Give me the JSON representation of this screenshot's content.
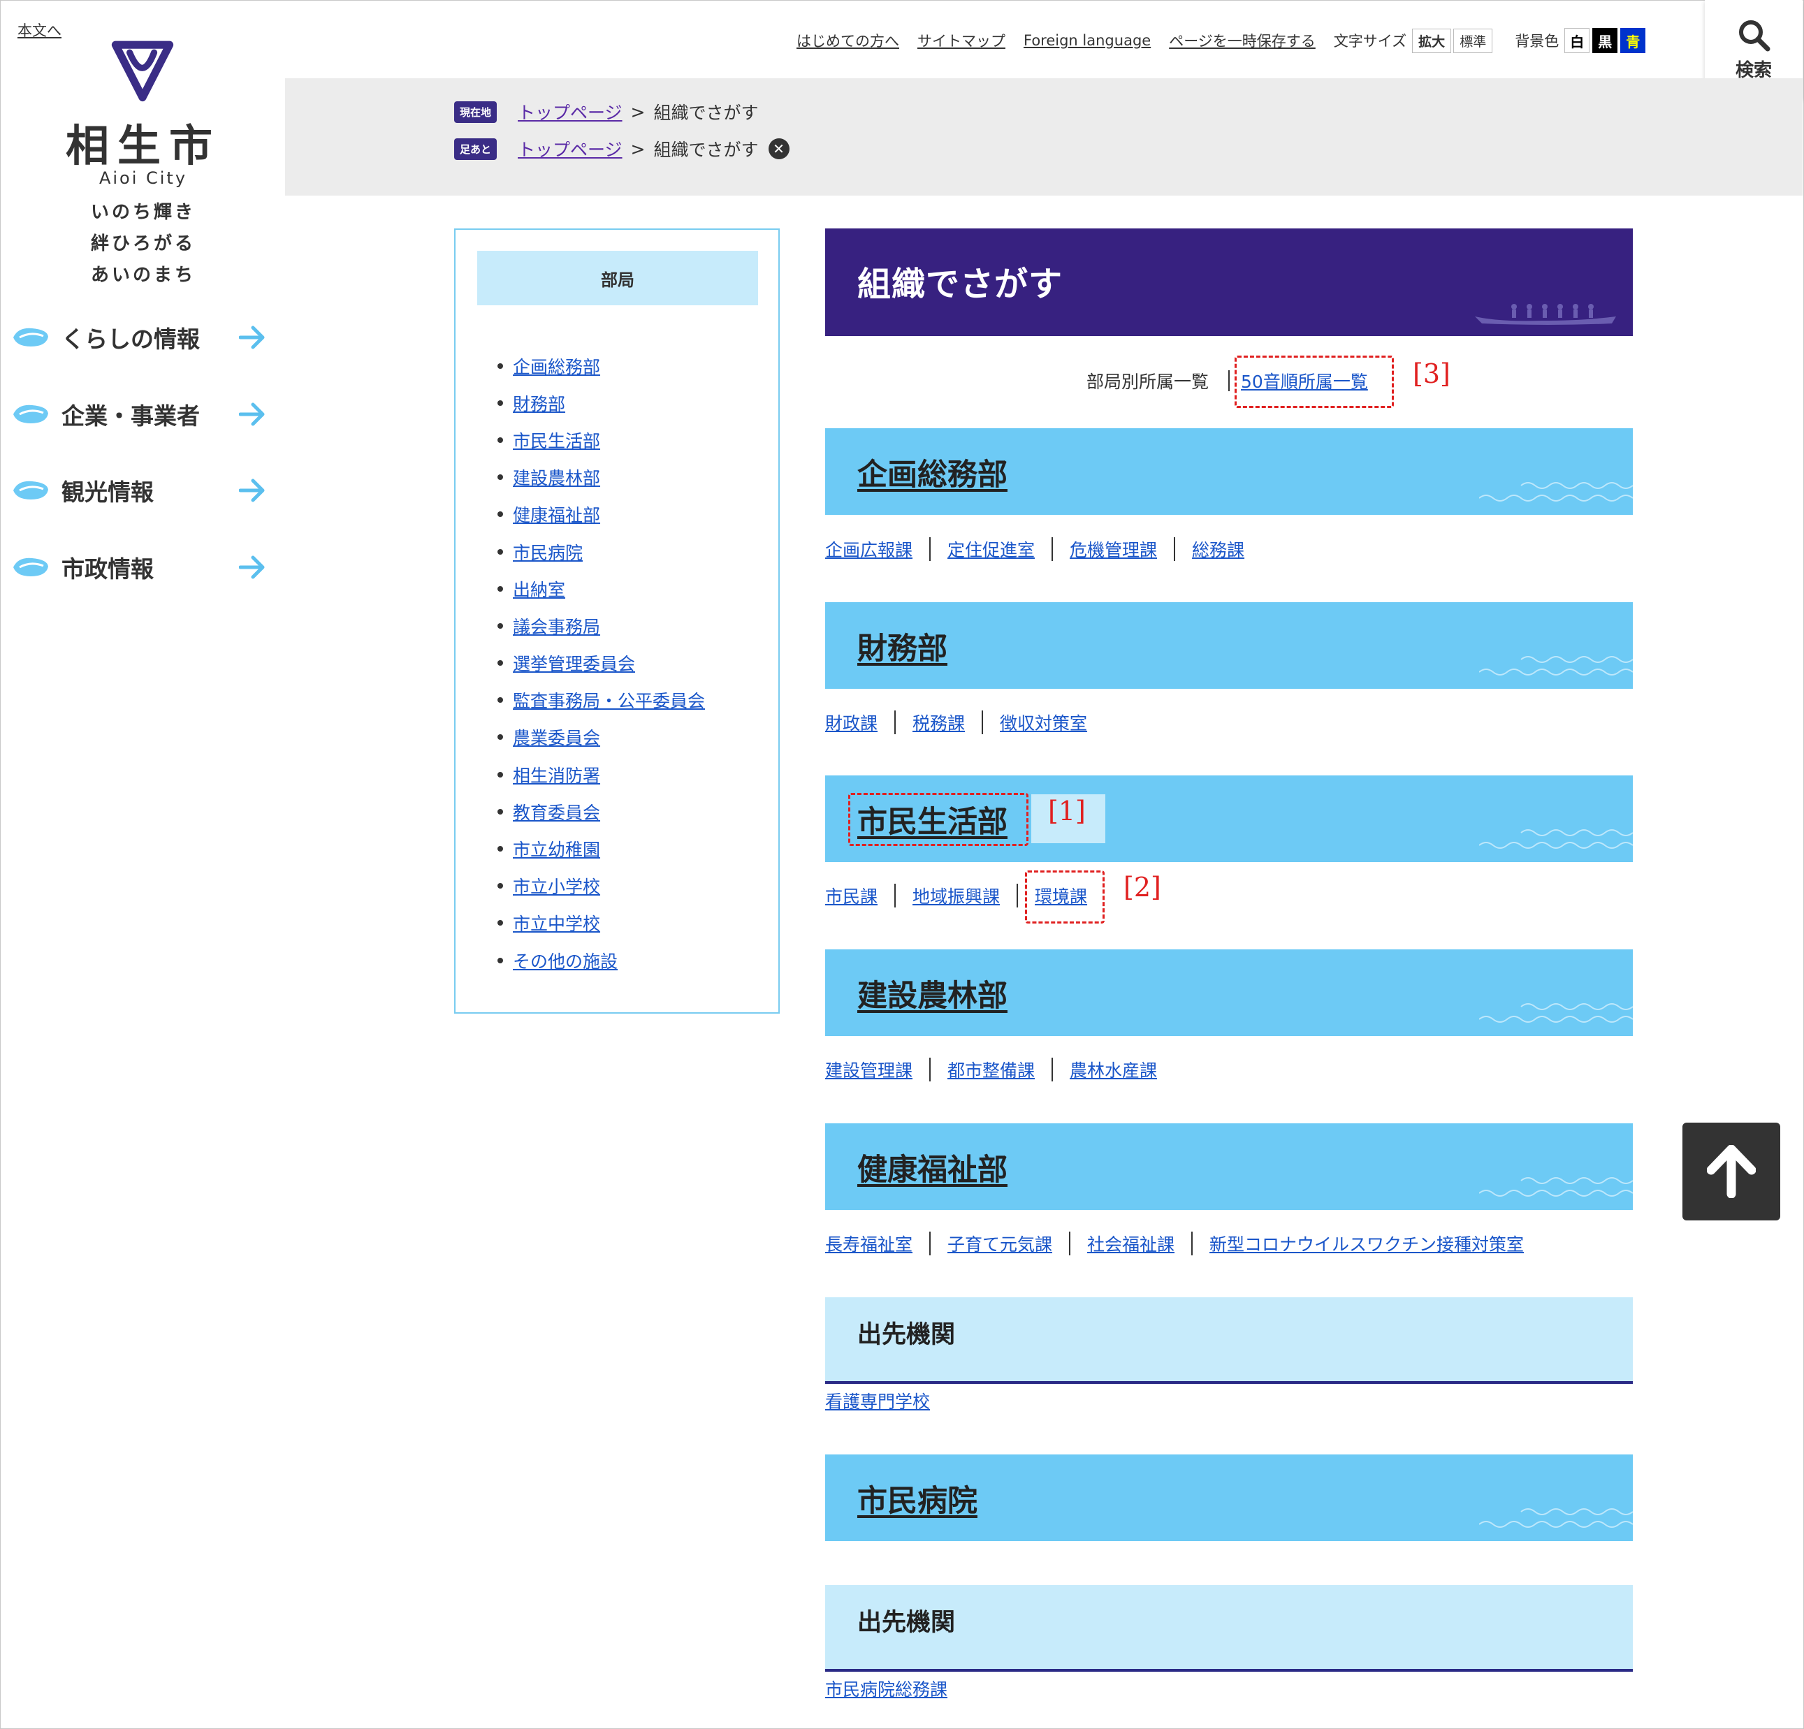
{
  "skip_link": "本文へ",
  "city": {
    "name": "相生市",
    "name_en": "Aioi City",
    "slogan": [
      "いのち輝き",
      "絆ひろがる",
      "あいのまち"
    ]
  },
  "global_nav": [
    {
      "label": "くらしの情報"
    },
    {
      "label": "企業・事業者"
    },
    {
      "label": "観光情報"
    },
    {
      "label": "市政情報"
    }
  ],
  "utility": {
    "links": [
      "はじめての方へ",
      "サイトマップ",
      "Foreign language",
      "ページを一時保存する"
    ],
    "font_size_label": "文字サイズ",
    "font_size_buttons": [
      "拡大",
      "標準"
    ],
    "bg_label": "背景色",
    "bg_buttons": [
      {
        "label": "白",
        "bg": "#ffffff",
        "fg": "#000000"
      },
      {
        "label": "黒",
        "bg": "#000000",
        "fg": "#ffffff"
      },
      {
        "label": "青",
        "bg": "#0033cc",
        "fg": "#ffff00"
      }
    ],
    "search_label": "検索"
  },
  "breadcrumb": {
    "current_badge": "現在地",
    "history_badge": "足あと",
    "top_link": "トップページ",
    "separator": ">",
    "current_page": "組織でさがす"
  },
  "side_menu": {
    "heading": "部局",
    "items": [
      "企画総務部",
      "財務部",
      "市民生活部",
      "建設農林部",
      "健康福祉部",
      "市民病院",
      "出納室",
      "議会事務局",
      "選挙管理委員会",
      "監査事務局・公平委員会",
      "農業委員会",
      "相生消防署",
      "教育委員会",
      "市立幼稚園",
      "市立小学校",
      "市立中学校",
      "その他の施設"
    ]
  },
  "main": {
    "title": "組織でさがす",
    "subnav": {
      "current": "部局別所属一覧",
      "link": "50音順所属一覧"
    },
    "departments": [
      {
        "name": "企画総務部",
        "sections": [
          "企画広報課",
          "定住促進室",
          "危機管理課",
          "総務課"
        ]
      },
      {
        "name": "財務部",
        "sections": [
          "財政課",
          "税務課",
          "徴収対策室"
        ]
      },
      {
        "name": "市民生活部",
        "sections": [
          "市民課",
          "地域振興課",
          "環境課"
        ]
      },
      {
        "name": "建設農林部",
        "sections": [
          "建設管理課",
          "都市整備課",
          "農林水産課"
        ]
      },
      {
        "name": "健康福祉部",
        "sections": [
          "長寿福祉室",
          "子育て元気課",
          "社会福祉課",
          "新型コロナウイルスワクチン接種対策室"
        ]
      },
      {
        "name": "市民病院"
      }
    ],
    "outposts": [
      {
        "title": "出先機関",
        "links": [
          "看護専門学校"
        ]
      },
      {
        "title": "出先機関",
        "links": [
          "市民病院総務課"
        ]
      }
    ]
  },
  "annotations": [
    "[1]",
    "[2]",
    "[3]"
  ],
  "colors": {
    "title_bg": "#372180",
    "dept_bg": "#6dcaf5",
    "sub_bg": "#c7ebfb",
    "annotation": "#e02020",
    "link": "#1a56c9"
  },
  "icons": [
    "logo-mark",
    "oyster-icon",
    "arrow-right-icon",
    "search-icon",
    "close-icon",
    "boat-illustration",
    "wave-icon",
    "arrow-up-icon"
  ]
}
